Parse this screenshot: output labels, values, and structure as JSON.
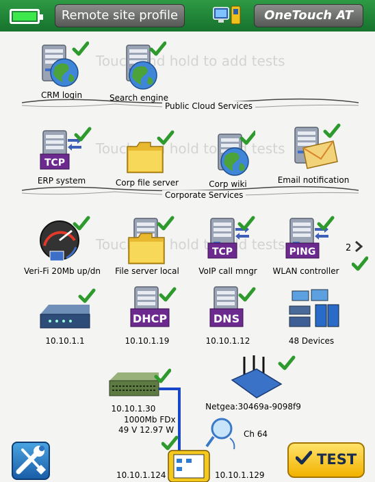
{
  "header": {
    "profile_label": "Remote site profile",
    "model_label": "OneTouch AT"
  },
  "hint_text": "Touch and hold to add tests",
  "groups": {
    "public_cloud": "Public Cloud Services",
    "corporate": "Corporate Services"
  },
  "tests": {
    "crm": "CRM login",
    "search": "Search engine",
    "erp": "ERP system",
    "erp_badge": "TCP",
    "corp_file": "Corp file server",
    "corp_wiki": "Corp wiki",
    "email": "Email notification",
    "verifi": "Veri-Fi 20Mb up/dn",
    "file_local": "File server local",
    "voip": "VoIP call mngr",
    "voip_badge": "TCP",
    "wlan": "WLAN controller",
    "wlan_badge": "PING"
  },
  "page_indicator": "2",
  "infra": {
    "router_ip": "10.10.1.1",
    "dhcp_badge": "DHCP",
    "dhcp_ip": "10.10.1.19",
    "dns_badge": "DNS",
    "dns_ip": "10.10.1.12",
    "devices": "48 Devices"
  },
  "topology": {
    "switch_ip": "10.10.1.30",
    "link_speed": "1000Mb FDx",
    "poe": "49 V 12.97 W",
    "ap_name": "Netgea:30469a-9098f9",
    "channel": "Ch 64",
    "wired_ip": "10.10.1.124",
    "wifi_ip": "10.10.1.129"
  },
  "buttons": {
    "test_label": "TEST"
  },
  "colors": {
    "header_green": "#1f8a39",
    "check_green": "#2e9a2e",
    "link_blue": "#1846c8",
    "test_yellow": "#f6c623"
  }
}
